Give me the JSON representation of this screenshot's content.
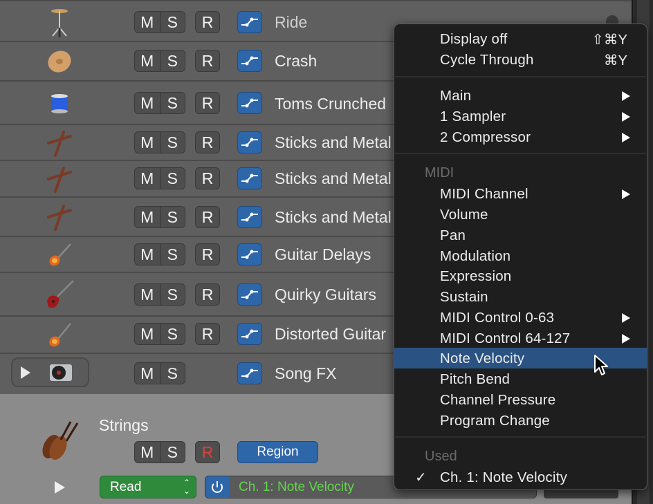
{
  "tracks": [
    {
      "name": "Ride",
      "icon": "ride-cymbal-icon",
      "has_record": true
    },
    {
      "name": "Crash",
      "icon": "crash-cymbal-icon",
      "has_record": true
    },
    {
      "name": "Toms Crunched",
      "icon": "tom-drum-icon",
      "has_record": true
    },
    {
      "name": "Sticks and Metal",
      "icon": "drumsticks-icon",
      "has_record": true
    },
    {
      "name": "Sticks and Metal",
      "icon": "drumsticks-icon",
      "has_record": true
    },
    {
      "name": "Sticks and Metal",
      "icon": "drumsticks-icon",
      "has_record": true
    },
    {
      "name": "Guitar Delays",
      "icon": "electric-guitar-icon",
      "has_record": true
    },
    {
      "name": "Quirky Guitars",
      "icon": "sg-guitar-icon",
      "has_record": true
    },
    {
      "name": "Distorted Guitar",
      "icon": "electric-guitar-icon",
      "has_record": true
    },
    {
      "name": "Song FX",
      "icon": "turntable-icon",
      "has_record": false
    }
  ],
  "buttons": {
    "mute": "M",
    "solo": "S",
    "record": "R"
  },
  "selected_track": {
    "name": "Strings",
    "icon": "violin-icon",
    "region_label": "Region",
    "automation_mode": "Read",
    "automation_parameter": "Ch. 1: Note Velocity",
    "record_color": "#e0403a",
    "parameter_color": "#5fd84a"
  },
  "menu": {
    "group1": [
      {
        "label": "Display off",
        "shortcut": "⇧⌘Y"
      },
      {
        "label": "Cycle Through",
        "shortcut": "⌘Y"
      }
    ],
    "group2": [
      {
        "label": "Main",
        "submenu": true
      },
      {
        "label": "1 Sampler",
        "submenu": true
      },
      {
        "label": "2 Compressor",
        "submenu": true
      }
    ],
    "midi_header": "MIDI",
    "midi_items": [
      {
        "label": "MIDI Channel",
        "submenu": true
      },
      {
        "label": "Volume",
        "submenu": false
      },
      {
        "label": "Pan",
        "submenu": false
      },
      {
        "label": "Modulation",
        "submenu": false
      },
      {
        "label": "Expression",
        "submenu": false
      },
      {
        "label": "Sustain",
        "submenu": false
      },
      {
        "label": "MIDI Control 0-63",
        "submenu": true
      },
      {
        "label": "MIDI Control 64-127",
        "submenu": true
      },
      {
        "label": "Note Velocity",
        "submenu": false,
        "highlighted": true
      },
      {
        "label": "Pitch Bend",
        "submenu": false
      },
      {
        "label": "Channel Pressure",
        "submenu": false
      },
      {
        "label": "Program Change",
        "submenu": false
      }
    ],
    "used_header": "Used",
    "used_items": [
      {
        "label": "Ch. 1: Note Velocity",
        "checked": true
      }
    ]
  },
  "colors": {
    "highlight": "#2a5282",
    "automation_blue": "#2e66aa",
    "read_green": "#2f8a3c"
  }
}
